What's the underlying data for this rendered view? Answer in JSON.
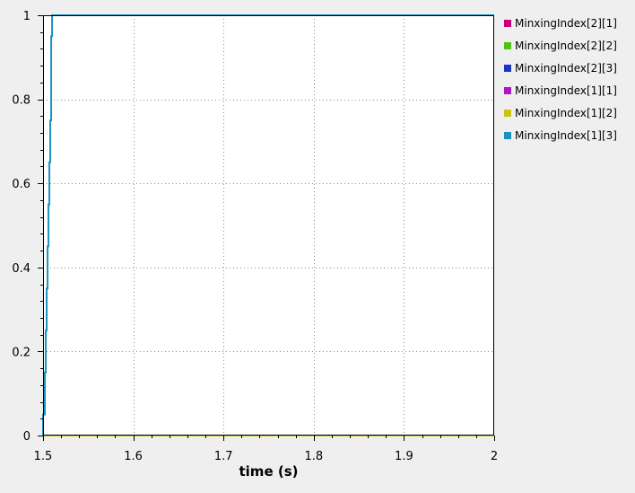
{
  "chart_data": {
    "type": "line",
    "title": "",
    "xlabel": "time (s)",
    "ylabel": "",
    "xlim": [
      1.5,
      2.0
    ],
    "ylim": [
      0,
      1
    ],
    "x_ticks": [
      "1.5",
      "1.6",
      "1.7",
      "1.8",
      "1.9",
      "2"
    ],
    "y_ticks": [
      "0",
      "0.2",
      "0.4",
      "0.6",
      "0.8",
      "1"
    ],
    "grid": true,
    "legend_position": "right",
    "series": [
      {
        "name": "MinxingIndex[2][1]",
        "color": "#c8007a",
        "x": [
          1.5,
          2.0
        ],
        "y": [
          0,
          0
        ]
      },
      {
        "name": "MinxingIndex[2][2]",
        "color": "#4fc214",
        "x": [
          1.5,
          2.0
        ],
        "y": [
          0,
          0
        ]
      },
      {
        "name": "MinxingIndex[2][3]",
        "color": "#1a34c8",
        "x": [
          1.5,
          2.0
        ],
        "y": [
          0,
          0
        ]
      },
      {
        "name": "MinxingIndex[1][1]",
        "color": "#b214c8",
        "x": [
          1.5,
          2.0
        ],
        "y": [
          0,
          0
        ]
      },
      {
        "name": "MinxingIndex[1][2]",
        "color": "#c8c414",
        "x": [
          1.5,
          2.0
        ],
        "y": [
          0,
          0
        ]
      },
      {
        "name": "MinxingIndex[1][3]",
        "color": "#1a92c0",
        "x": [
          1.5,
          1.5,
          1.502,
          1.502,
          1.503,
          1.503,
          1.504,
          1.504,
          1.505,
          1.505,
          1.506,
          1.506,
          1.507,
          1.507,
          1.508,
          1.508,
          1.509,
          1.509,
          1.51,
          1.51,
          2.0
        ],
        "y": [
          0,
          0.05,
          0.05,
          0.15,
          0.15,
          0.25,
          0.25,
          0.35,
          0.35,
          0.45,
          0.45,
          0.55,
          0.55,
          0.65,
          0.65,
          0.75,
          0.75,
          0.95,
          0.95,
          1.0,
          1.0
        ]
      }
    ]
  }
}
